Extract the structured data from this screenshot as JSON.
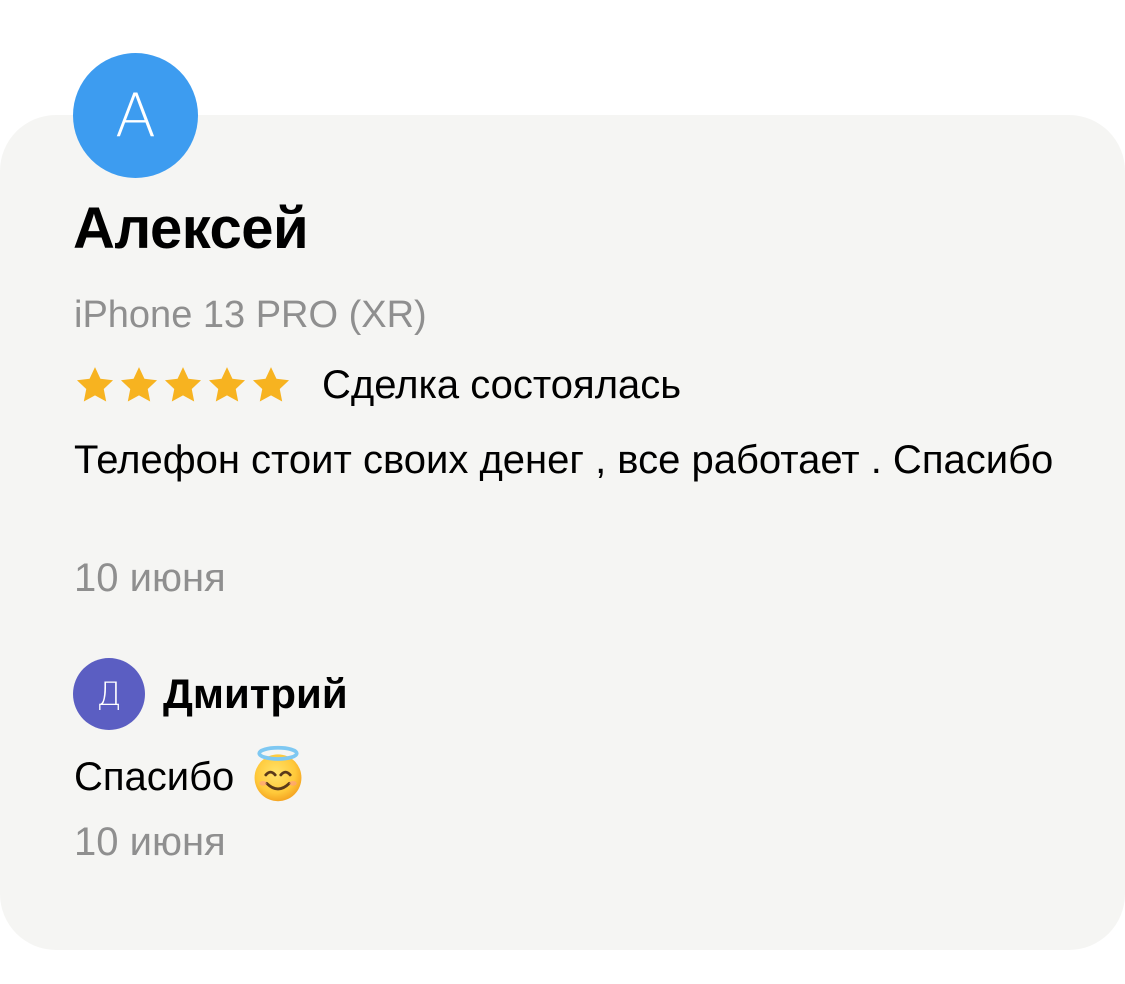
{
  "review": {
    "avatar_letter": "А",
    "author": "Алексей",
    "device": "iPhone 13 PRO (XR)",
    "rating": 5,
    "rating_max": 5,
    "star_color": "#f7b320",
    "deal_status": "Сделка состоялась",
    "text": "Телефон стоит своих денег , все работает . Спасибо",
    "date": "10 июня",
    "avatar_color": "#3d9cf0"
  },
  "reply": {
    "avatar_letter": "Д",
    "author": "Дмитрий",
    "text": "Спасибо",
    "emoji": "smiling-face-with-halo-icon",
    "date": "10 июня",
    "avatar_color": "#5b5ec2"
  }
}
